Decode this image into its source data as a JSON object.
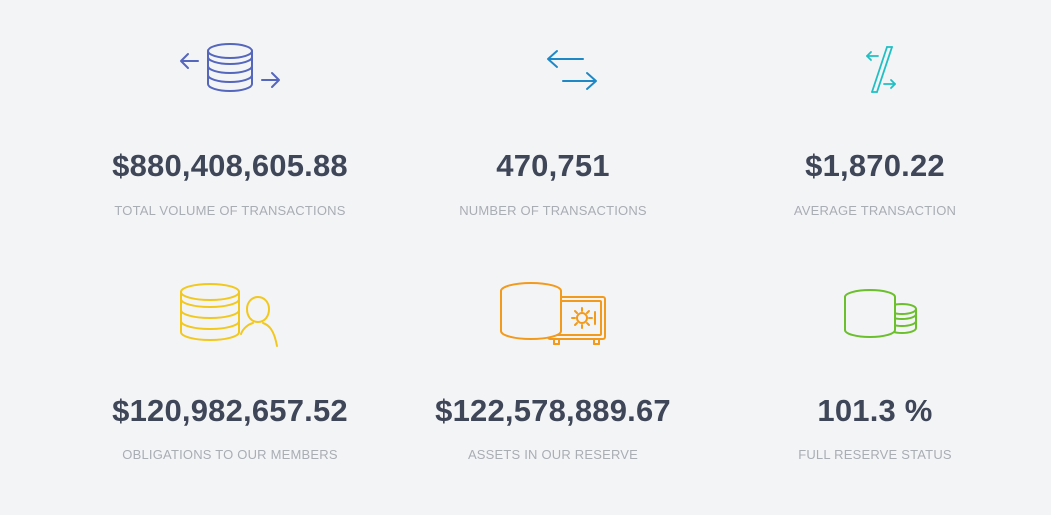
{
  "colors": {
    "background": "#f3f4f6",
    "value_text": "#3f4658",
    "label_text": "#a9adb4",
    "icon_volume": "#5566bd",
    "icon_count": "#1e88c7",
    "icon_average": "#1fc0c4",
    "icon_obligations": "#f2c81e",
    "icon_assets": "#f39a1c",
    "icon_reserve": "#6cbf2c"
  },
  "stats": [
    {
      "value": "$880,408,605.88",
      "label": "TOTAL VOLUME OF TRANSACTIONS",
      "icon": "coins-exchange-icon"
    },
    {
      "value": "470,751",
      "label": "NUMBER OF TRANSACTIONS",
      "icon": "arrows-exchange-icon"
    },
    {
      "value": "$1,870.22",
      "label": "AVERAGE TRANSACTION",
      "icon": "slash-arrows-icon"
    },
    {
      "value": "$120,982,657.52",
      "label": "OBLIGATIONS TO OUR MEMBERS",
      "icon": "coins-user-icon"
    },
    {
      "value": "$122,578,889.67",
      "label": "ASSETS IN OUR RESERVE",
      "icon": "coins-safe-icon"
    },
    {
      "value": "101.3 %",
      "label": "FULL RESERVE STATUS",
      "icon": "coin-stacks-icon"
    }
  ]
}
